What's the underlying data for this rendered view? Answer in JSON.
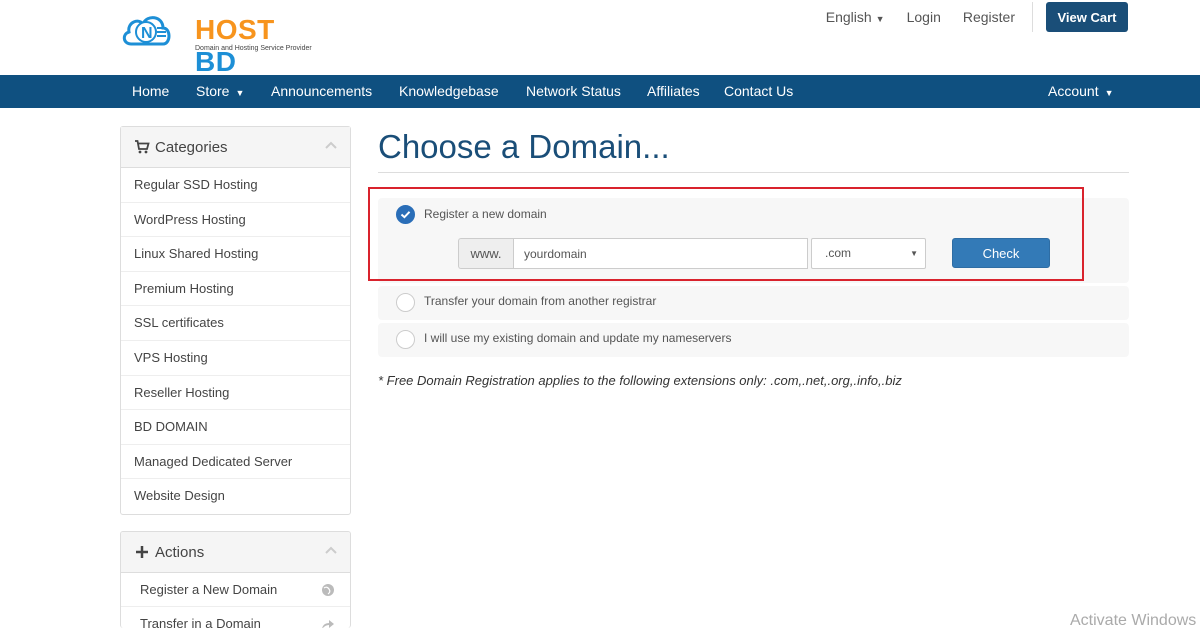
{
  "logo": {
    "text_primary": "HOST",
    "text_secondary": "BD",
    "badge_letter": "N",
    "tagline": "Domain and Hosting Service Provider"
  },
  "top_links": {
    "language": "English",
    "login": "Login",
    "register": "Register",
    "view_cart": "View Cart"
  },
  "nav": {
    "home": "Home",
    "store": "Store",
    "announcements": "Announcements",
    "knowledgebase": "Knowledgebase",
    "network_status": "Network Status",
    "affiliates": "Affiliates",
    "contact": "Contact Us",
    "account": "Account"
  },
  "sidebar": {
    "categories_title": "Categories",
    "categories": [
      "Regular SSD Hosting",
      "WordPress Hosting",
      "Linux Shared Hosting",
      "Premium Hosting",
      "SSL certificates",
      "VPS Hosting",
      "Reseller Hosting",
      "BD DOMAIN",
      "Managed Dedicated Server",
      "Website Design"
    ],
    "actions_title": "Actions",
    "actions": [
      {
        "label": "Register a New Domain",
        "icon": "globe-icon"
      },
      {
        "label": "Transfer in a Domain",
        "icon": "share-icon"
      }
    ]
  },
  "main": {
    "title": "Choose a Domain...",
    "options": {
      "register": "Register a new domain",
      "transfer": "Transfer your domain from another registrar",
      "existing": "I will use my existing domain and update my nameservers"
    },
    "www_prefix": "www.",
    "domain_value": "yourdomain",
    "tld_selected": ".com",
    "check_label": "Check",
    "note": "* Free Domain Registration applies to the following extensions only: .com,.net,.org,.info,.biz"
  },
  "watermark": "Activate Windows",
  "colors": {
    "brand_navy": "#1a4e78",
    "nav_blue": "#0f5080",
    "button_blue": "#337ab7",
    "highlight_red": "#d9232d",
    "logo_orange": "#f7941d"
  }
}
